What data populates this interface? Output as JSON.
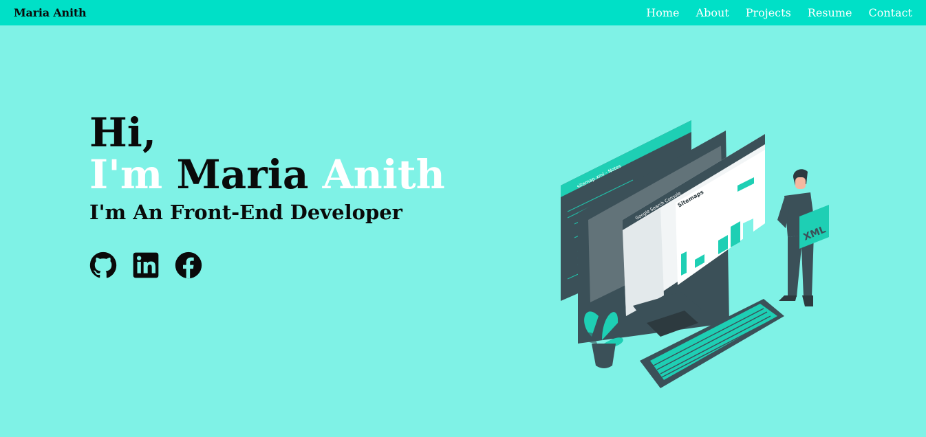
{
  "nav": {
    "brand": "Maria Anith",
    "links": [
      "Home",
      "About",
      "Projects",
      "Resume",
      "Contact"
    ]
  },
  "hero": {
    "greeting": "Hi,",
    "im": "I'm",
    "first_name": "Maria",
    "last_name": "Anith",
    "role": "I'm An Front-End Developer"
  },
  "socials": {
    "icons": [
      "github-icon",
      "linkedin-icon",
      "facebook-icon"
    ]
  },
  "illustration": {
    "window_title": "sitemap.xml - Notes",
    "console_title": "Google Search Console",
    "panel_title": "Sitemaps",
    "badge_text": "XML"
  },
  "colors": {
    "background": "#7ff2e6",
    "navbar": "#00e0c7",
    "accent": "#1ecfb4",
    "dark": "#3b5058"
  }
}
